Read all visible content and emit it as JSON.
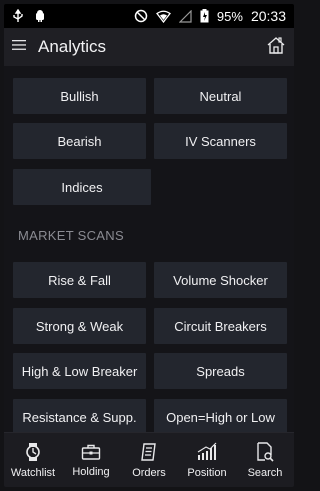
{
  "status_bar": {
    "battery": "95%",
    "time": "20:33"
  },
  "appbar": {
    "title": "Analytics"
  },
  "top_buttons": [
    {
      "label": "Bullish"
    },
    {
      "label": "Neutral"
    },
    {
      "label": "Bearish"
    },
    {
      "label": "IV Scanners"
    },
    {
      "label": "Indices"
    }
  ],
  "market_scans": {
    "title": "MARKET SCANS",
    "items": [
      {
        "label": "Rise & Fall"
      },
      {
        "label": "Volume Shocker"
      },
      {
        "label": "Strong & Weak"
      },
      {
        "label": "Circuit Breakers"
      },
      {
        "label": "High & Low Breaker"
      },
      {
        "label": "Spreads"
      },
      {
        "label": "Resistance & Supp."
      },
      {
        "label": "Open=High or Low"
      }
    ]
  },
  "bottom_nav": [
    {
      "label": "Watchlist",
      "icon": "watch-icon"
    },
    {
      "label": "Holding",
      "icon": "briefcase-icon"
    },
    {
      "label": "Orders",
      "icon": "orders-icon"
    },
    {
      "label": "Position",
      "icon": "position-chart-icon"
    },
    {
      "label": "Search",
      "icon": "search-doc-icon"
    }
  ]
}
